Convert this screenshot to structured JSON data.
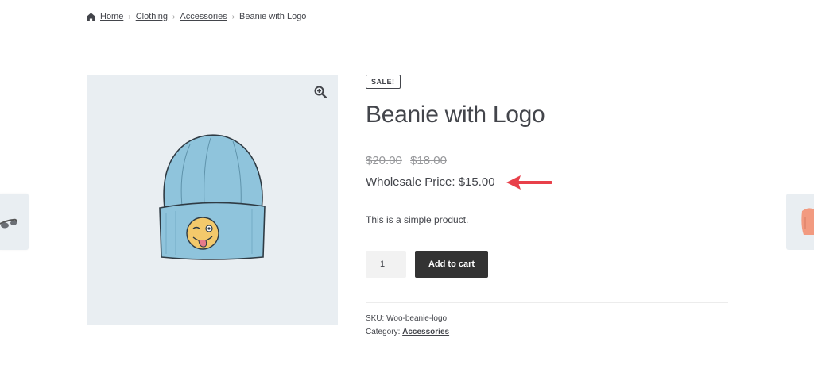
{
  "breadcrumb": {
    "home": "Home",
    "clothing": "Clothing",
    "accessories": "Accessories",
    "current": "Beanie with Logo"
  },
  "product": {
    "sale_badge": "SALE!",
    "title": "Beanie with Logo",
    "regular_price": "$20.00",
    "sale_price": "$18.00",
    "wholesale_price": "Wholesale Price: $15.00",
    "description": "This is a simple product.",
    "quantity": "1",
    "add_to_cart": "Add to cart",
    "sku_label": "SKU:",
    "sku": "Woo-beanie-logo",
    "category_label": "Category:",
    "category": "Accessories"
  },
  "colors": {
    "text": "#43454b",
    "button_bg": "#333333",
    "image_bg": "#e9eef2",
    "arrow": "#e8404a",
    "beanie": "#8fc4dc",
    "emoji": "#f3c96b"
  },
  "icons": {
    "home": "home-icon",
    "zoom": "zoom-in-icon",
    "arrow": "red-arrow-icon"
  }
}
